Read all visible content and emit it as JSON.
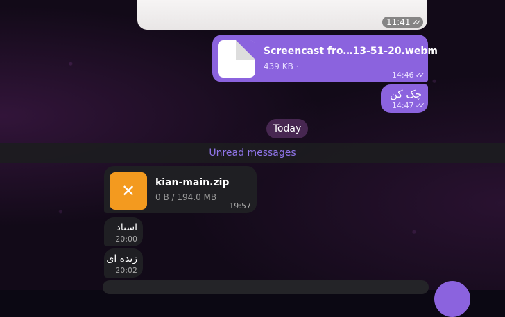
{
  "messages": {
    "top_time": "11:41",
    "outgoing_file": {
      "name": "Screencast fro…13-51-20.webm",
      "size": "439 KB ·",
      "time": "14:46"
    },
    "outgoing_text": {
      "text": "چک کن",
      "time": "14:47"
    },
    "date_separator": "Today",
    "unread_label": "Unread messages",
    "incoming_file": {
      "name": "kian-main.zip",
      "progress": "0 B / 194.0 MB",
      "time": "19:57"
    },
    "incoming_text_1": {
      "text": "استاد",
      "time": "20:00"
    },
    "incoming_text_2": {
      "text": "زنده ای",
      "time": "20:02"
    }
  },
  "icons": {
    "read_receipt": "double-check-icon",
    "file": "document-icon",
    "cancel": "close-icon"
  },
  "colors": {
    "outgoing_bubble": "#8b63de",
    "incoming_bubble": "#1f1f23",
    "accent": "#8e73e6",
    "zip_icon": "#f39a1f"
  }
}
